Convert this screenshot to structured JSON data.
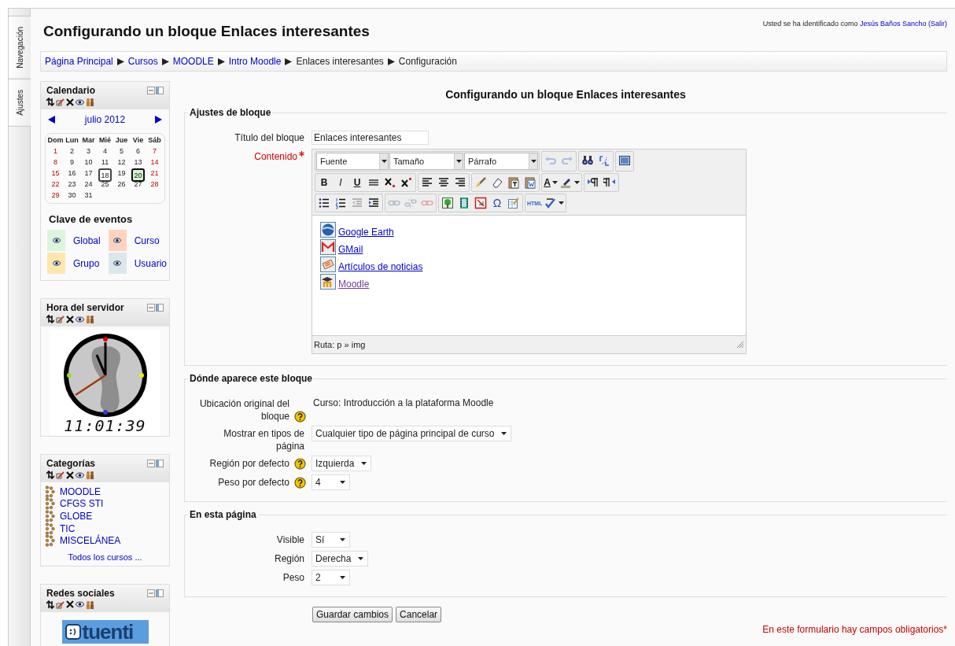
{
  "side_tabs": [
    "Navegación",
    "Ajustes"
  ],
  "header": {
    "title": "Configurando un bloque Enlaces interesantes",
    "login_prefix": "Usted se ha identificado como",
    "user": "Jesús Baños Sancho",
    "logout": "(Salir)"
  },
  "breadcrumb": [
    {
      "label": "Página Principal",
      "link": true
    },
    {
      "label": "Cursos",
      "link": true
    },
    {
      "label": "MOODLE",
      "link": true
    },
    {
      "label": "Intro Moodle",
      "link": true
    },
    {
      "label": "Enlaces interesantes",
      "link": false
    },
    {
      "label": "Configuración",
      "link": false
    }
  ],
  "calendar": {
    "title": "Calendario",
    "month": "julio 2012",
    "weekdays": [
      "Dom",
      "Lun",
      "Mar",
      "Mié",
      "Jue",
      "Vie",
      "Sáb"
    ],
    "days": [
      {
        "d": "1",
        "today": false,
        "event": false
      },
      {
        "d": "2",
        "today": false,
        "event": false
      },
      {
        "d": "3",
        "today": false,
        "event": false
      },
      {
        "d": "4",
        "today": false,
        "event": false
      },
      {
        "d": "5",
        "today": false,
        "event": false
      },
      {
        "d": "6",
        "today": false,
        "event": false
      },
      {
        "d": "7",
        "today": false,
        "event": false
      },
      {
        "d": "8",
        "today": false,
        "event": false
      },
      {
        "d": "9",
        "today": false,
        "event": false
      },
      {
        "d": "10",
        "today": false,
        "event": false
      },
      {
        "d": "11",
        "today": false,
        "event": false
      },
      {
        "d": "12",
        "today": false,
        "event": false
      },
      {
        "d": "13",
        "today": false,
        "event": false
      },
      {
        "d": "14",
        "today": false,
        "event": false
      },
      {
        "d": "15",
        "today": false,
        "event": false
      },
      {
        "d": "16",
        "today": false,
        "event": false
      },
      {
        "d": "17",
        "today": false,
        "event": false
      },
      {
        "d": "18",
        "today": true,
        "event": false
      },
      {
        "d": "19",
        "today": false,
        "event": false
      },
      {
        "d": "20",
        "today": false,
        "event": true
      },
      {
        "d": "21",
        "today": false,
        "event": false
      },
      {
        "d": "22",
        "today": false,
        "event": false
      },
      {
        "d": "23",
        "today": false,
        "event": false
      },
      {
        "d": "24",
        "today": false,
        "event": false
      },
      {
        "d": "25",
        "today": false,
        "event": false
      },
      {
        "d": "26",
        "today": false,
        "event": false
      },
      {
        "d": "27",
        "today": false,
        "event": false
      },
      {
        "d": "28",
        "today": false,
        "event": false
      },
      {
        "d": "29",
        "today": false,
        "event": false
      },
      {
        "d": "30",
        "today": false,
        "event": false
      },
      {
        "d": "31",
        "today": false,
        "event": false
      }
    ],
    "events_title": "Clave de eventos",
    "events": [
      {
        "label": "Global",
        "color": "#dcf5dc"
      },
      {
        "label": "Curso",
        "color": "#ffd3bd"
      },
      {
        "label": "Grupo",
        "color": "#fee7ae"
      },
      {
        "label": "Usuario",
        "color": "#dce7ec"
      }
    ]
  },
  "clock": {
    "title": "Hora del servidor",
    "time": "11:01:39"
  },
  "categories": {
    "title": "Categorías",
    "items": [
      "MOODLE",
      "CFGS STI",
      "GLOBE",
      "TIC",
      "MISCELÁNEA"
    ],
    "all": "Todos los cursos ..."
  },
  "social": {
    "title": "Redes sociales",
    "logo": "tuenti"
  },
  "form": {
    "heading": "Configurando un bloque Enlaces interesantes",
    "sections": [
      {
        "legend": "Ajustes de bloque",
        "fields": [
          {
            "kind": "text",
            "label": "Título del bloque",
            "value": "Enlaces interesantes",
            "required": false,
            "help": false
          },
          {
            "kind": "editor",
            "label": "Contenido",
            "required": true,
            "help": false
          }
        ]
      },
      {
        "legend": "Dónde aparece este bloque",
        "fields": [
          {
            "kind": "static",
            "label": "Ubicación original del bloque",
            "value": "Curso: Introducción a la plataforma Moodle",
            "required": false,
            "help": true
          },
          {
            "kind": "select",
            "label": "Mostrar en tipos de página",
            "value": "Cualquier tipo de página principal de curso",
            "required": false,
            "help": false
          },
          {
            "kind": "select",
            "label": "Región por defecto",
            "value": "Izquierda",
            "required": false,
            "help": true
          },
          {
            "kind": "select",
            "label": "Peso por defecto",
            "value": "4",
            "required": false,
            "help": true
          }
        ]
      },
      {
        "legend": "En esta página",
        "fields": [
          {
            "kind": "select",
            "label": "Visible",
            "value": "Sí",
            "required": false,
            "help": false
          },
          {
            "kind": "select",
            "label": "Región",
            "value": "Derecha",
            "required": false,
            "help": false
          },
          {
            "kind": "select",
            "label": "Peso",
            "value": "2",
            "required": false,
            "help": false
          }
        ]
      }
    ],
    "editor": {
      "toolbar": [
        [
          [
            {
              "kind": "select",
              "label": "Fuente"
            },
            {
              "kind": "select",
              "label": "Tamaño"
            },
            {
              "kind": "select",
              "label": "Párrafo"
            }
          ],
          [
            {
              "kind": "icon",
              "disabled": true,
              "menu": false
            },
            {
              "kind": "icon",
              "disabled": true,
              "menu": false
            }
          ],
          [
            {
              "kind": "icon",
              "disabled": false,
              "menu": false
            },
            {
              "kind": "icon",
              "disabled": false,
              "menu": false
            }
          ],
          [
            {
              "kind": "icon",
              "disabled": false,
              "menu": false
            }
          ]
        ],
        [
          [
            {
              "kind": "bold",
              "label": "B",
              "disabled": false,
              "menu": false
            },
            {
              "kind": "italic",
              "label": "I",
              "disabled": false,
              "menu": false
            },
            {
              "kind": "underline",
              "label": "U",
              "disabled": false,
              "menu": false
            },
            {
              "kind": "icon",
              "disabled": false,
              "menu": false
            },
            {
              "kind": "icon",
              "disabled": false,
              "menu": false
            },
            {
              "kind": "icon",
              "disabled": false,
              "menu": false
            }
          ],
          [
            {
              "kind": "icon",
              "disabled": false,
              "menu": false
            },
            {
              "kind": "icon",
              "disabled": false,
              "menu": false
            },
            {
              "kind": "icon",
              "disabled": false,
              "menu": false
            }
          ],
          [
            {
              "kind": "icon",
              "disabled": false,
              "menu": false
            },
            {
              "kind": "icon",
              "disabled": false,
              "menu": false
            },
            {
              "kind": "icon",
              "disabled": false,
              "menu": false
            },
            {
              "kind": "icon",
              "disabled": false,
              "menu": false
            }
          ],
          [
            {
              "kind": "underline",
              "label": "A",
              "disabled": false,
              "menu": true
            },
            {
              "kind": "icon",
              "disabled": false,
              "menu": true
            }
          ],
          [
            {
              "kind": "icon",
              "disabled": false,
              "menu": false
            },
            {
              "kind": "icon",
              "disabled": false,
              "menu": false
            }
          ]
        ],
        [
          [
            {
              "kind": "icon",
              "disabled": false,
              "menu": false
            },
            {
              "kind": "icon",
              "disabled": false,
              "menu": false
            },
            {
              "kind": "icon",
              "disabled": true,
              "menu": false
            },
            {
              "kind": "icon",
              "disabled": false,
              "menu": false
            }
          ],
          [
            {
              "kind": "icon",
              "disabled": true,
              "menu": false
            },
            {
              "kind": "icon",
              "disabled": true,
              "menu": false
            },
            {
              "kind": "icon",
              "disabled": true,
              "menu": false
            }
          ],
          [
            {
              "kind": "icon",
              "disabled": false,
              "menu": false
            },
            {
              "kind": "icon",
              "disabled": false,
              "menu": false
            },
            {
              "kind": "icon",
              "disabled": false,
              "menu": false
            },
            {
              "kind": "symbol",
              "label": "Ω",
              "disabled": false,
              "menu": false
            },
            {
              "kind": "icon",
              "disabled": false,
              "menu": false
            }
          ],
          [
            {
              "kind": "small",
              "label": "HTML",
              "disabled": false,
              "menu": false
            },
            {
              "kind": "icon",
              "disabled": false,
              "menu": true
            }
          ]
        ]
      ],
      "links": [
        {
          "text": "Google Earth",
          "visited": false
        },
        {
          "text": "GMail",
          "visited": false
        },
        {
          "text": "Artículos de noticias",
          "visited": false
        },
        {
          "text": "Moodle",
          "visited": true
        }
      ],
      "path": "Ruta: p » img"
    },
    "buttons": [
      {
        "label": "Guardar cambios"
      },
      {
        "label": "Cancelar"
      }
    ],
    "required_note": "En este formulario hay campos obligatorios*"
  }
}
